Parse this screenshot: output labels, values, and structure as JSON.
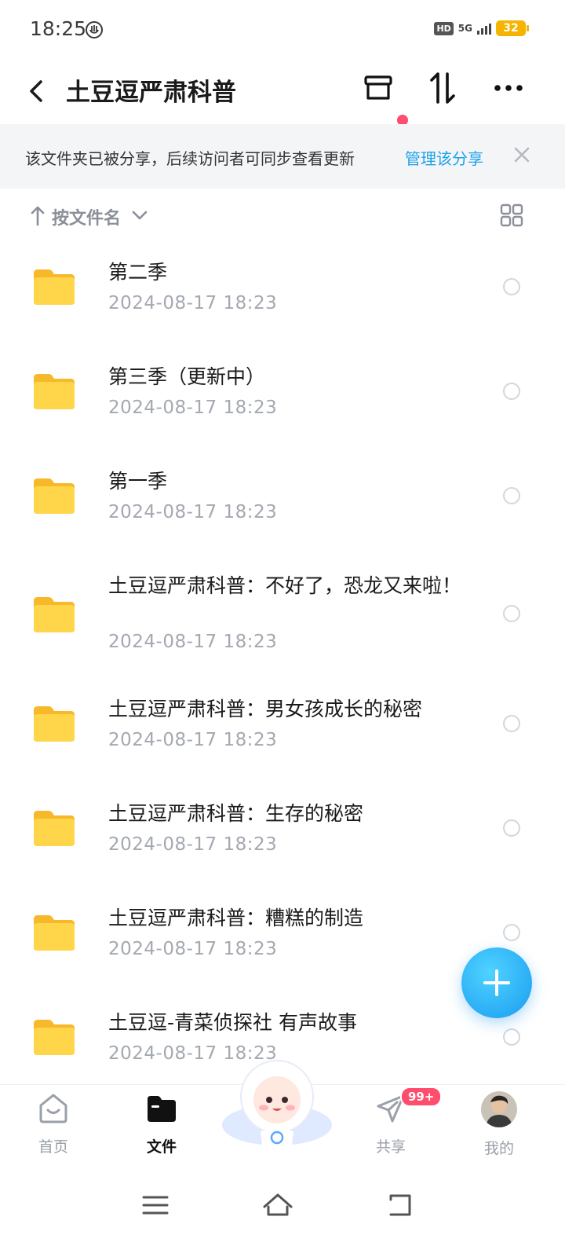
{
  "status_bar": {
    "time": "18:25",
    "hd": "HD",
    "network": "5G",
    "battery": "32"
  },
  "header": {
    "title": "土豆逗严肃科普"
  },
  "banner": {
    "text": "该文件夹已被分享，后续访问者可同步查看更新",
    "link": "管理该分享"
  },
  "sort": {
    "label": "按文件名"
  },
  "files": [
    {
      "name": "第二季",
      "date": "2024-08-17  18:23"
    },
    {
      "name": "第三季（更新中）",
      "date": "2024-08-17  18:23"
    },
    {
      "name": "第一季",
      "date": "2024-08-17  18:23"
    },
    {
      "name": "土豆逗严肃科普：不好了，恐龙又来啦！",
      "date": "2024-08-17  18:23"
    },
    {
      "name": "土豆逗严肃科普：男女孩成长的秘密",
      "date": "2024-08-17  18:23"
    },
    {
      "name": "土豆逗严肃科普：生存的秘密",
      "date": "2024-08-17  18:23"
    },
    {
      "name": "土豆逗严肃科普：糟糕的制造",
      "date": "2024-08-17  18:23"
    },
    {
      "name": "土豆逗-青菜侦探社 有声故事",
      "date": "2024-08-17  18:23"
    }
  ],
  "bottom_nav": {
    "home": "首页",
    "files": "文件",
    "share": "共享",
    "share_badge": "99+",
    "mine": "我的"
  },
  "colors": {
    "accent": "#1da2e8",
    "folder": "#ffcc33",
    "badge": "#ff4d6d"
  }
}
